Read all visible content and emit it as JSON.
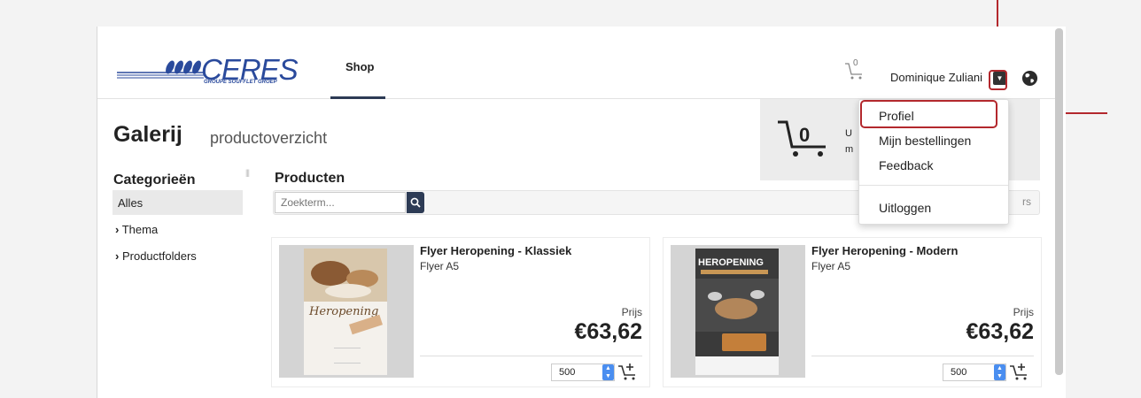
{
  "header": {
    "logo_text": "CERES",
    "logo_sub": "GROUPE SOUFFLET GROEP",
    "nav_shop": "Shop",
    "cart_count": "0",
    "user_name": "Dominique Zuliani"
  },
  "page": {
    "title": "Galerij",
    "subtitle": "productoverzicht"
  },
  "cart_summary": {
    "count": "0",
    "text_line1": "U",
    "text_line2": "m"
  },
  "sidebar": {
    "title": "Categorieën",
    "items": [
      {
        "label": "Alles"
      },
      {
        "label": "Thema"
      },
      {
        "label": "Productfolders"
      }
    ]
  },
  "products": {
    "title": "Producten",
    "search_placeholder": "Zoekterm...",
    "filter_tail": "rs",
    "items": [
      {
        "name": "Flyer Heropening - Klassiek",
        "type": "Flyer A5",
        "price_label": "Prijs",
        "price": "€63,62",
        "qty": "500",
        "poster_text": "Heropening"
      },
      {
        "name": "Flyer Heropening - Modern",
        "type": "Flyer A5",
        "price_label": "Prijs",
        "price": "€63,62",
        "qty": "500",
        "poster_text": "HEROPENING"
      }
    ]
  },
  "dropdown": {
    "items": [
      "Profiel",
      "Mijn bestellingen",
      "Feedback",
      "Uitloggen"
    ]
  },
  "colors": {
    "accent_dark": "#2d3b55",
    "logo_blue": "#2a4a9c",
    "highlight_red": "#b3282d",
    "spinner_blue": "#4a8ef0"
  }
}
